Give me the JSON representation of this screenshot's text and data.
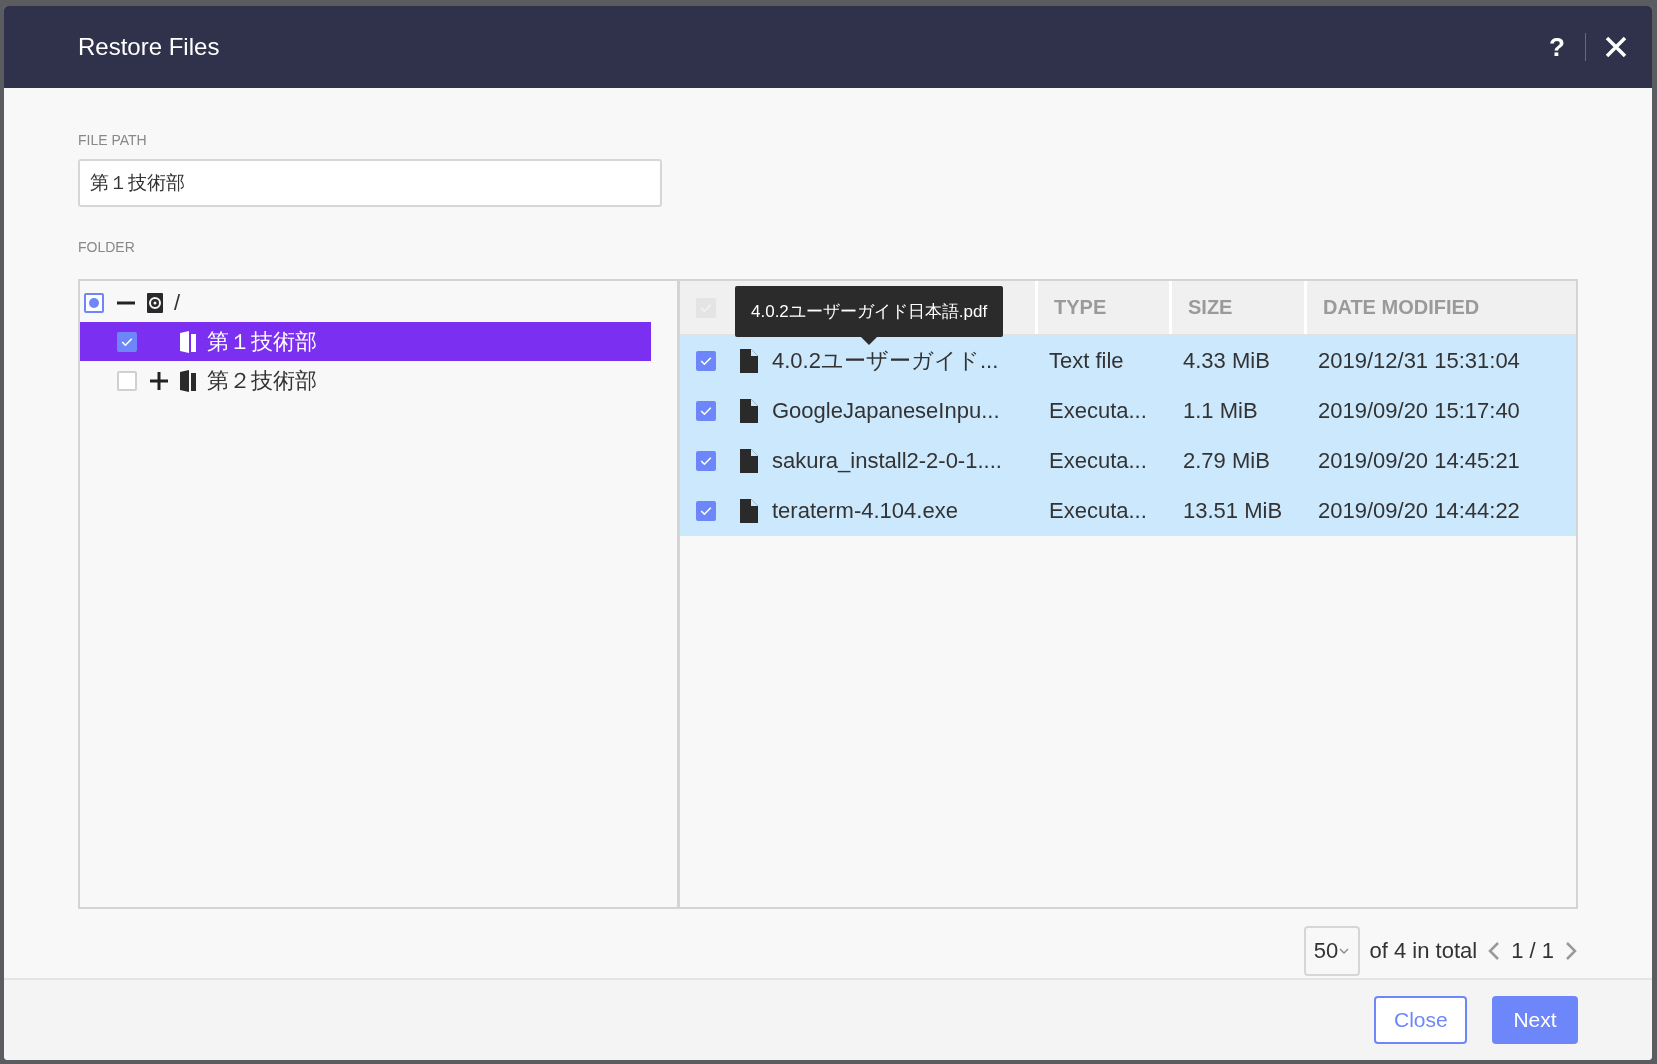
{
  "dialog": {
    "title": "Restore Files",
    "help": "?"
  },
  "file_path": {
    "label": "FILE PATH",
    "value": "第１技術部"
  },
  "folder": {
    "label": "FOLDER"
  },
  "tree": [
    {
      "label": "/",
      "kind": "drive",
      "checked": false,
      "partial": true,
      "selected": false,
      "expandable": true,
      "expanded": true,
      "children": [
        {
          "label": "第１技術部",
          "kind": "folder",
          "checked": true,
          "partial": false,
          "selected": true,
          "expandable": false
        },
        {
          "label": "第２技術部",
          "kind": "folder",
          "checked": false,
          "partial": false,
          "selected": false,
          "expandable": true,
          "expanded": false
        }
      ]
    }
  ],
  "table": {
    "select_all": {
      "checked": true,
      "disabled": true
    },
    "columns": [
      "TYPE",
      "SIZE",
      "DATE MODIFIED"
    ],
    "tooltip": "4.0.2ユーザーガイド日本語.pdf",
    "rows": [
      {
        "checked": true,
        "selected": true,
        "name": "4.0.2ユーザーガイド...",
        "type": "Text file",
        "size": "4.33 MiB",
        "date": "2019/12/31 15:31:04"
      },
      {
        "checked": true,
        "selected": true,
        "name": "GoogleJapaneseInpu...",
        "type": "Executa...",
        "size": "1.1 MiB",
        "date": "2019/09/20 15:17:40"
      },
      {
        "checked": true,
        "selected": true,
        "name": "sakura_install2-2-0-1....",
        "type": "Executa...",
        "size": "2.79 MiB",
        "date": "2019/09/20 14:45:21"
      },
      {
        "checked": true,
        "selected": true,
        "name": "teraterm-4.104.exe",
        "type": "Executa...",
        "size": "13.51 MiB",
        "date": "2019/09/20 14:44:22"
      }
    ]
  },
  "pagination": {
    "page_size": "50",
    "total": "of 4 in total",
    "page": "1 / 1"
  },
  "buttons": [
    {
      "label": "Close",
      "kind": "secondary"
    },
    {
      "label": "Next",
      "kind": "primary"
    }
  ]
}
